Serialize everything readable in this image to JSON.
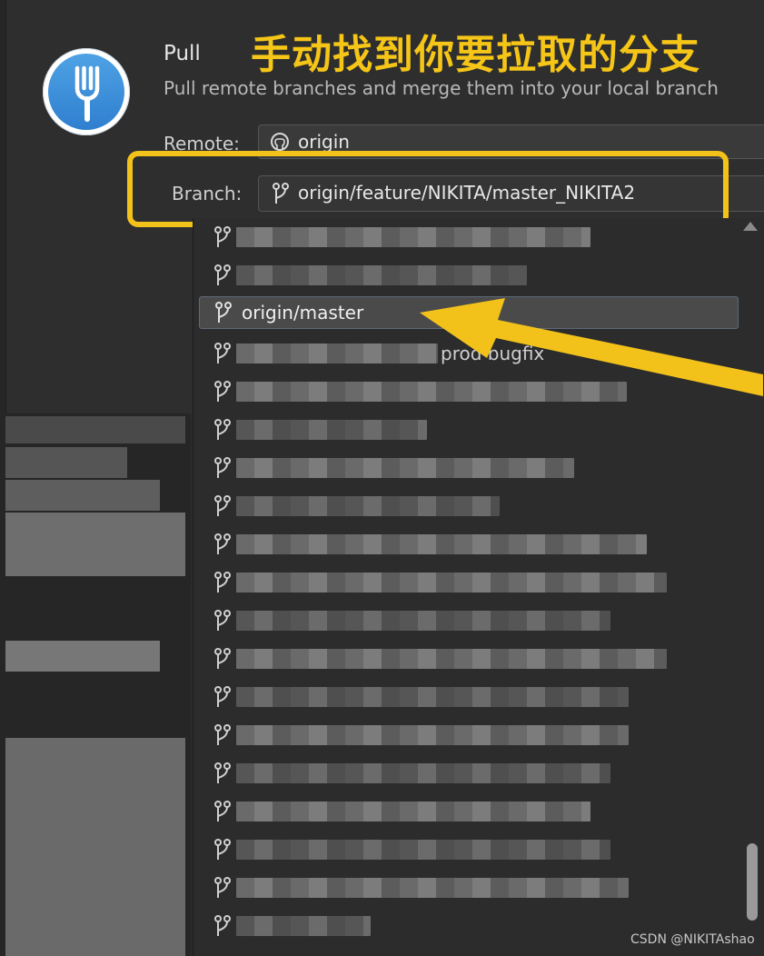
{
  "dialog": {
    "title": "Pull",
    "subtitle": "Pull remote branches and merge them into your local branch",
    "remote_label": "Remote:",
    "remote_value": "origin",
    "branch_label": "Branch:",
    "branch_value": "origin/feature/NIKITA/master_NIKITA2"
  },
  "annotation": {
    "text": "手动找到你要拉取的分支",
    "color": "#f2c21b"
  },
  "branch_list": {
    "selected": "origin/master",
    "partial_visible": "prod bugfix"
  },
  "icons": {
    "app": "fork-icon",
    "remote": "github-icon",
    "branch": "branch-icon"
  },
  "watermark": "CSDN @NIKITAshao"
}
